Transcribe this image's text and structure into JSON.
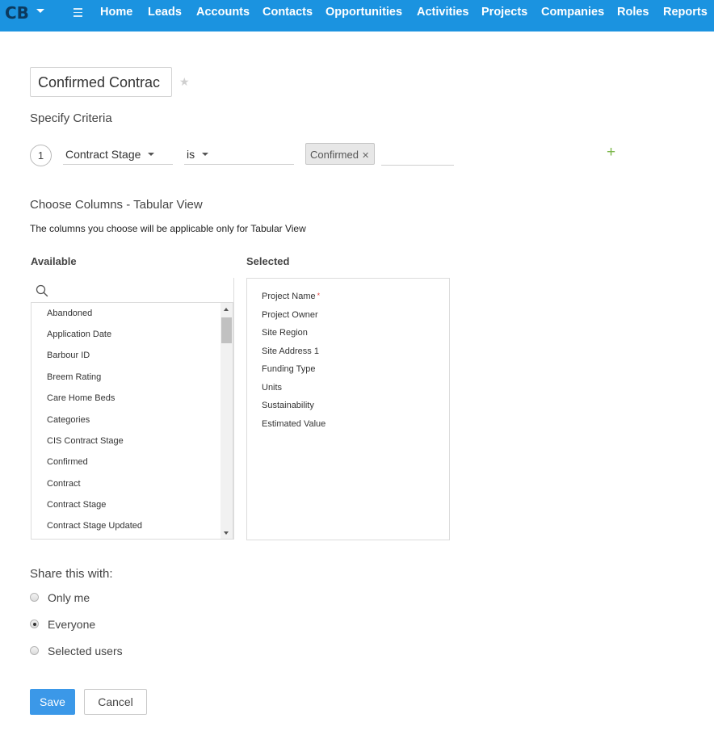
{
  "app": {
    "logo_text": "CB",
    "brand_color": "#1b93e0",
    "nav": [
      "Home",
      "Leads",
      "Accounts",
      "Contacts",
      "Opportunities",
      "Activities",
      "Projects",
      "Companies",
      "Roles",
      "Reports"
    ]
  },
  "view": {
    "name_value": "Confirmed Contrac"
  },
  "criteria": {
    "title": "Specify Criteria",
    "rows": [
      {
        "number": "1",
        "field": "Contract Stage",
        "operator": "is",
        "values": [
          "Confirmed"
        ]
      }
    ]
  },
  "columns": {
    "title": "Choose Columns - Tabular View",
    "hint": "The columns you choose will be applicable only for Tabular View",
    "available_label": "Available",
    "selected_label": "Selected",
    "available": [
      "Abandoned",
      "Application Date",
      "Barbour ID",
      "Breem Rating",
      "Care Home Beds",
      "Categories",
      "CIS Contract Stage",
      "Confirmed",
      "Contract",
      "Contract Stage",
      "Contract Stage Updated"
    ],
    "selected": [
      "Project Name",
      "Project Owner",
      "Site Region",
      "Site Address 1",
      "Funding Type",
      "Units",
      "Sustainability",
      "Estimated Value"
    ],
    "required_mark": "*"
  },
  "share": {
    "title": "Share this with:",
    "options": [
      "Only me",
      "Everyone",
      "Selected users"
    ],
    "selected": "Everyone"
  },
  "actions": {
    "save": "Save",
    "cancel": "Cancel"
  }
}
